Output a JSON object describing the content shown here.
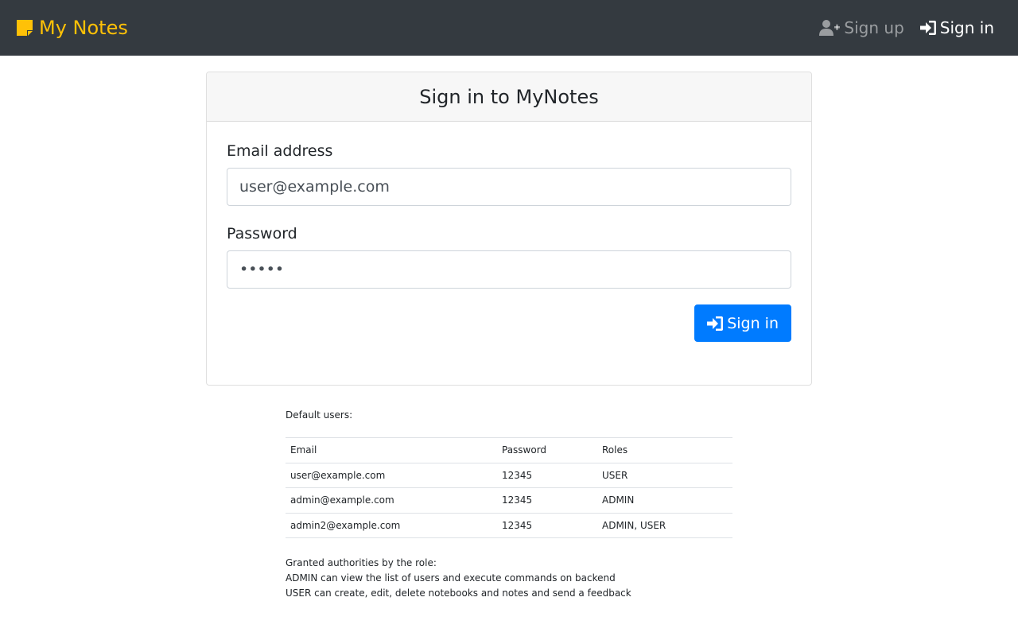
{
  "navbar": {
    "brand": "My Notes",
    "signup_label": "Sign up",
    "signin_label": "Sign in"
  },
  "form": {
    "header": "Sign in to MyNotes",
    "email_label": "Email address",
    "email_value": "user@example.com",
    "password_label": "Password",
    "password_value": "12345",
    "submit_label": "Sign in"
  },
  "defaults": {
    "title": "Default users:",
    "headers": [
      "Email",
      "Password",
      "Roles"
    ],
    "rows": [
      [
        "user@example.com",
        "12345",
        "USER"
      ],
      [
        "admin@example.com",
        "12345",
        "ADMIN"
      ],
      [
        "admin2@example.com",
        "12345",
        "ADMIN, USER"
      ]
    ]
  },
  "authorities": {
    "title": "Granted authorities by the role:",
    "lines": [
      "ADMIN can view the list of users and execute commands on backend",
      "USER can create, edit, delete notebooks and notes and send a feedback"
    ]
  },
  "colors": {
    "navbar_bg": "#343a40",
    "brand": "#ffc107",
    "primary": "#007bff"
  },
  "icons": {
    "brand": "sticky-note-icon",
    "signup": "user-plus-icon",
    "signin": "sign-in-icon"
  }
}
